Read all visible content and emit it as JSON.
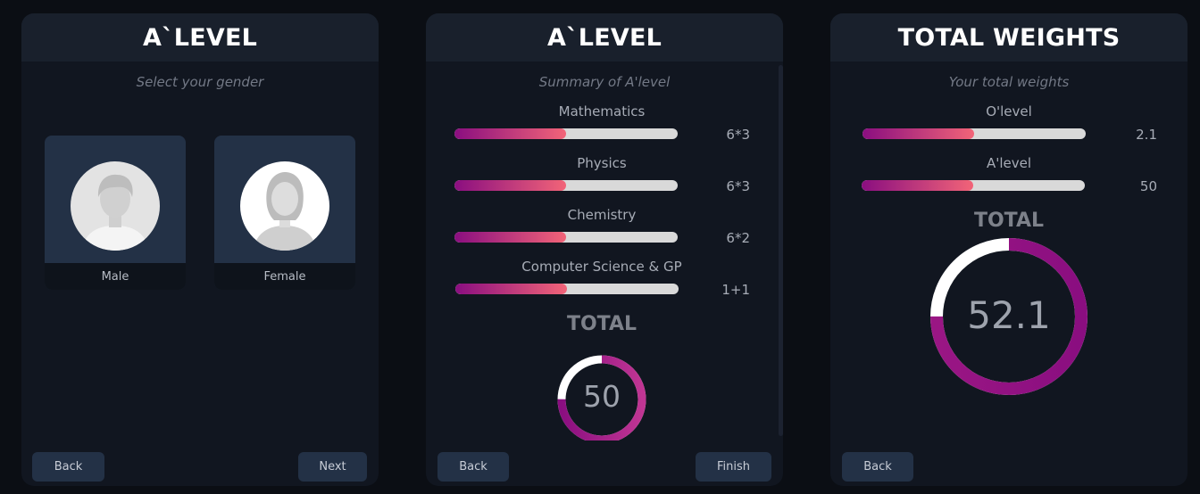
{
  "panel1": {
    "title": "A`LEVEL",
    "subtitle": "Select your gender",
    "cards": [
      {
        "label": "Male",
        "icon": "male-avatar-icon"
      },
      {
        "label": "Female",
        "icon": "female-avatar-icon"
      }
    ],
    "back_label": "Back",
    "next_label": "Next"
  },
  "panel2": {
    "title": "A`LEVEL",
    "subtitle": "Summary of A'level",
    "subjects": [
      {
        "label": "Mathematics",
        "value": "6*3",
        "progress": 0.5
      },
      {
        "label": "Physics",
        "value": "6*3",
        "progress": 0.5
      },
      {
        "label": "Chemistry",
        "value": "6*2",
        "progress": 0.5
      },
      {
        "label": "Computer Science & GP",
        "value": "1+1",
        "progress": 0.5
      }
    ],
    "total_label": "TOTAL",
    "total_value": "50",
    "total_fraction": 0.75,
    "back_label": "Back",
    "finish_label": "Finish"
  },
  "panel3": {
    "title": "TOTAL WEIGHTS",
    "subtitle": "Your total weights",
    "items": [
      {
        "label": "O'level",
        "value": "2.1",
        "progress": 0.5
      },
      {
        "label": "A'level",
        "value": "50",
        "progress": 0.5
      }
    ],
    "total_label": "TOTAL",
    "total_value": "52.1",
    "total_fraction": 0.75,
    "back_label": "Back"
  },
  "colors": {
    "accent_start": "#8a0e80",
    "accent_end": "#f26478",
    "button_bg": "#233146",
    "panel_bg": "#111620"
  }
}
